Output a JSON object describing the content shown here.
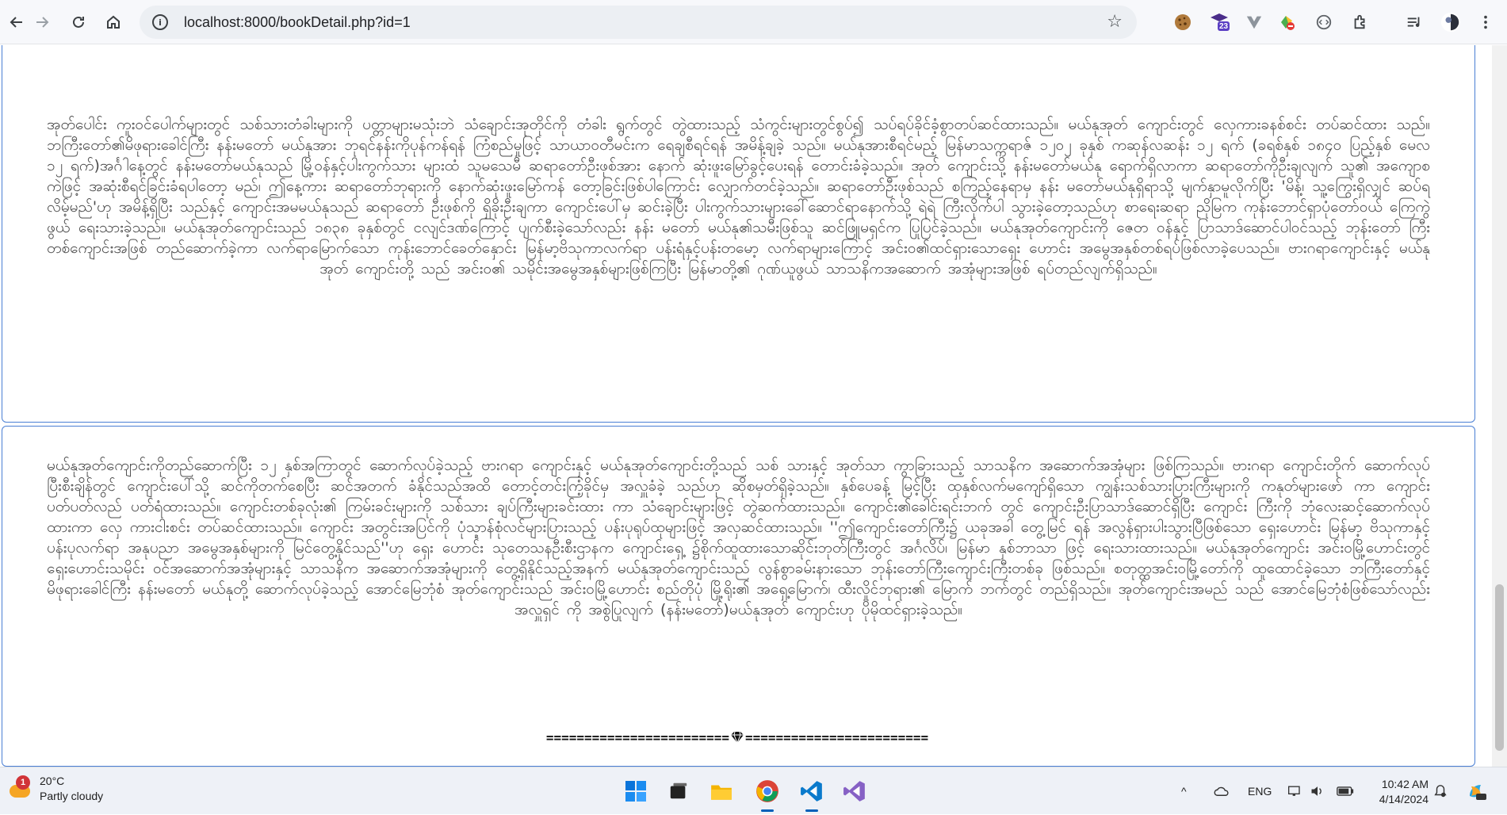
{
  "browser": {
    "url": "localhost:8000/bookDetail.php?id=1",
    "extension_badge": "23"
  },
  "content": {
    "paragraph1": "အုတ်ပေါင်း ကူးဝင်ပေါက်များတွင် သစ်သားတံခါးများကို ပတ္တာများမသုံးဘဲ သံချောင်းအုတိုင်ကို တံခါး ရွက်တွင် တွဲထားသည့် သံကွင်းများတွင်စွပ်၍ သပ်ရပ်ခိုင်ခံ့စွာတပ်ဆင်ထားသည်။ မယ်နုအုတ် ကျောင်းတွင် လှေကားခနစ်စင်း တပ်ဆင်ထား သည်။ ဘကြီးတော်၏မိဖုရားခေါင်ကြီး နန်းမတော် မယ်နုအား ဘုရင်နန်းကိုပုန်ကန်ရန် ကြံစည်မှုဖြင့် သာယာဝတီမင်းက ရေချစီရင်ရန် အမိန့်ချခဲ့ သည်။ မယ်နုအားစီရင်မည့် မြန်မာသက္ကရာဇ် ၁၂၀၂ ခုနှစ် ကဆုန်လဆန်း ၁၂ ရက် (ခရစ်နှစ် ၁၈၄၀ ပြည့်နှစ် မေလ ၁၂ ရက်)အင်္ဂါနေ့တွင် နန်းမတော်မယ်နုသည် မြို့ဝန်နှင့်ပါးကွက်သား များထံ သူမသေမီ ဆရာတော်ဦးဖုစ်အား နောက် ဆုံးဖူးမြော်ခွင့်ပေးရန် တောင်းခံခဲ့သည်။ အုတ် ကျောင်းသို့ နန်းမတော်မယ်နု ရောက်ရှိလာကာ ဆရာတော်ကိုဦးချလျက် သူ၏ အကျောစကဲဖြင့် အဆုံးစီရင်ခြင်းခံရပါတော့ မည်၊ ဤနေ့ကား ဆရာတော်ဘုရားကို နောက်ဆုံးဖူးမြော်ကန် တော့ခြင်းဖြစ်ပါကြောင်း လျှောက်တင်ခဲ့သည်။ ဆရာတော်ဦးဖုစ်သည် စကြည့်နေရာမှ နန်း မတော်မယ်နုရှိရာသို့ မျက်နှာမူလိုက်ပြီး 'မိန့်၊ သူ့ကြွေးရှိလျှင် ဆပ်ရလိမ့်မည်'ဟု အမိန့်ရှိပြီး သည်နှင့် ကျောင်းအမမယ်နုသည် ဆရာတော် ဦးဖုစ်ကို ရှိခိုးဦးချကာ ကျောင်းပေါ်မှ ဆင်းခဲ့ပြီး ပါးကွက်သားများခေါ်ဆောင်ရာနောက်သို့ ရဲရဲ ကြီးလိုက်ပါ သွားခဲ့တော့သည်ဟု စာရေးဆရာ ညိုမြက ကုန်းဘောင်ရှာပုံတော်ဝယ် ကြေကွဲဖွယ် ရေးသားခဲ့သည်။ မယ်နုအုတ်ကျောင်းသည် ၁၈၃၈ ခုနှစ်တွင် ငလျင်ဒဏ်ကြောင့် ပျက်စီးခဲ့သော်လည်း နန်း မတော် မယ်နု၏သမီးဖြစ်သူ ဆင်ဖြူမရှင်က ပြုပြင်ခဲ့သည်။ မယ်နုအုတ်ကျောင်းကို ဇေတ ဝန်နှင့် ပြာသာဒ်ဆောင်ပါဝင်သည့် ဘုန်းတော် ကြီးတစ်ကျောင်းအဖြစ် တည်ဆောက်ခဲ့ကာ လက်ရာမြောက်သော ကုန်းဘောင်ခေတ်နှောင်း မြန်မာ့ဗိသုကာလက်ရာ ပန်းရံနှင့်ပန်းတမော့ လက်ရာများကြောင့် အင်းဝ၏ထင်ရှားသောရှေး ဟောင်း အမွေအနှစ်တစ်ရပ်ဖြစ်လာခဲ့ပေသည်။ ဗားဂရာကျောင်းနှင့် မယ်နုအုတ် ကျောင်းတို့ သည် အင်းဝ၏ သမိုင်းအမွေအနှစ်များဖြစ်ကြပြီး မြန်မာတို့၏ ဂုဏ်ယူဖွယ် သာသနိကအဆောက် အအုံများအဖြစ် ရပ်တည်လျက်ရှိသည်။",
    "paragraph2": "မယ်နုအုတ်ကျောင်းကိုတည်ဆောက်ပြီး ၁၂ နှစ်အကြာတွင် ဆောက်လုပ်ခဲ့သည့် ဗားဂရာ ကျောင်းနှင့် မယ်နုအုတ်ကျောင်းတို့သည် သစ် သားနှင့် အုတ်သာ ကွာခြားသည့် သာသနိက အဆောက်အအုံများ ဖြစ်ကြသည်။ ဗားဂရာ ကျောင်းတိုက် ဆောက်လုပ်ပြီးစီးချိန်တွင် ကျောင်းပေါ်သို့ ဆင်ကိုတက်စေပြီး ဆင်အတက် ခံနိုင်သည်အထိ တောင့်တင်းကြံ့ခိုင်မှ အလှူခံခဲ့ သည်ဟု ဆိုစမှတ်ရှိခဲ့သည်။ နှစ်ပေခန့် မြင့်ပြီး ထုနှစ်လက်မကျော်ရှိသော ကျွန်းသစ်သားပြားကြီးများကို ကနုတ်များဖော် ကာ ကျောင်းပတ်ပတ်လည် ပတ်ရံထားသည်။ ကျောင်းတစ်ခုလုံး၏ ကြမ်းခင်းများကို သစ်သား ချပ်ကြီးများခင်းထား ကာ သံချောင်းများဖြင့် တွဲဆက်ထားသည်။ ကျောင်း၏ခေါင်းရင်းဘက် တွင် ကျောင်းဦးပြာသာဒ်ဆောင်ရှိပြီး ကျောင်း ကြီးကို ဘုံလေးဆင့်ဆောက်လုပ်ထားကာ လှေ ကားငါးစင်း တပ်ဆင်ထားသည်။ ကျောင်း အတွင်းအပြင်ကို ပုံသ္ဍာန်စုံလင်များပြားသည့် ပန်းပုရုပ်ထုများဖြင့် အလှဆင်ထားသည်။ ''ဤကျောင်းတော်ကြီး၌ ယခုအခါ တွေ့မြင် ရန် အလွန်ရှားပါးသွားပြီဖြစ်သော ရှေးဟောင်း မြန်မာ့ ဗိသုကာနှင့် ပန်းပုလက်ရာ အနုပညာ အမွေအနှစ်များကို မြင်တွေ့နိုင်သည်''ဟု ရှေး ဟောင်း သုတေသနဦးစီးဌာနက ကျောင်းရှေ့ ၌စိုက်ထူထားသောဆိုင်းဘုတ်ကြီးတွင် အင်္ဂလိပ်၊ မြန်မာ နှစ်ဘာသာ ဖြင့် ရေးသားထားသည်။ မယ်နုအုတ်ကျောင်း အင်းဝမြို့ဟောင်းတွင် ရှေးဟောင်းသမိုင်း ဝင်အဆောက်အအုံများနှင့် သာသနိက အဆောက်အအုံများကို တွေ့ရှိနိုင်သည့်အနက် မယ်နုအုတ်ကျောင်းသည် လွန်စွာခမ်းနားသော ဘုန်းတော်ကြီးကျောင်းကြီးတစ်ခု ဖြစ်သည်။ စတုတ္ထအင်းဝမြို့တော်ကို ထူထောင်ခဲ့သော ဘကြီးတော်နှင့် မိဖုရားခေါင်ကြီး နန်းမတော် မယ်နုတို့ ဆောက်လုပ်ခဲ့သည့် အောင်မြေဘုံစံ အုတ်ကျောင်းသည် အင်းဝမြို့ဟောင်း စည်တိုပုံ မြို့ရိုး၏ အရှေ့မြောက်၊ ထီးလှိုင်ဘုရား၏ မြောက် ဘက်တွင် တည်ရှိသည်။ အုတ်ကျောင်းအမည် သည် အောင်မြေဘုံစံဖြစ်သော်လည်း အလှူရှင် ကို အစွဲပြုလျက် (နန်းမတော်)မယ်နုအုတ် ကျောင်းဟု ပိုမိုထင်ရှားခဲ့သည်။",
    "divider_left": "========================",
    "divider_right": "========================"
  },
  "taskbar": {
    "weather_badge": "1",
    "temperature": "20°C",
    "condition": "Partly cloudy",
    "language": "ENG",
    "time": "10:42 AM",
    "date": "4/14/2024"
  },
  "colors": {
    "card_border": "#4a7fd4",
    "body_text": "#4a4a4a",
    "chrome_bg": "#f7f8fb",
    "taskbar_bg": "#eef1f7"
  }
}
